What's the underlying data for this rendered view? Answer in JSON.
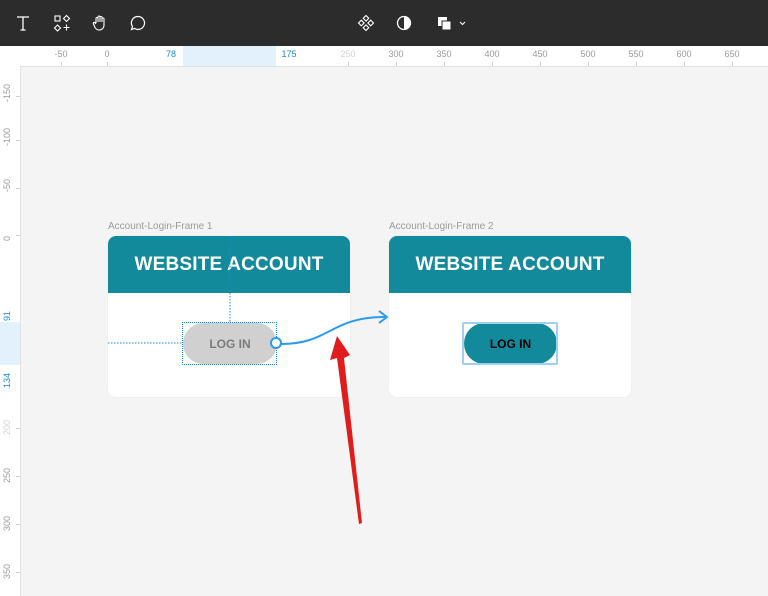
{
  "toolbar": {
    "tools": [
      {
        "icon": "text-tool-icon"
      },
      {
        "icon": "components-icon"
      },
      {
        "icon": "hand-tool-icon"
      },
      {
        "icon": "comment-icon"
      },
      {
        "icon": "component-diamond-icon"
      },
      {
        "icon": "contrast-icon"
      },
      {
        "icon": "shape-fill-icon"
      }
    ]
  },
  "rulers": {
    "x_ticks": [
      "-50",
      "0",
      "78",
      "175",
      "250",
      "300",
      "350",
      "400",
      "450",
      "500",
      "550",
      "600",
      "650"
    ],
    "y_ticks": [
      "-150",
      "-100",
      "-50",
      "0",
      "91",
      "134",
      "200",
      "250",
      "300",
      "350"
    ],
    "selected_x": [
      "78",
      "175"
    ],
    "selected_y": [
      "91",
      "134"
    ]
  },
  "frames": [
    {
      "label": "Account-Login-Frame 1",
      "header": "WEBSITE ACCOUNT",
      "button": "LOG IN"
    },
    {
      "label": "Account-Login-Frame 2",
      "header": "WEBSITE ACCOUNT",
      "button": "LOG IN"
    }
  ],
  "colors": {
    "toolbar_bg": "#2c2c2c",
    "canvas_bg": "#f4f4f4",
    "header_teal": "#128a9c",
    "selection_blue": "#1a8ad8",
    "connector_blue": "#2b9af3",
    "arrow_red": "#e01c1c",
    "button_inactive": "#d0d0d0"
  }
}
